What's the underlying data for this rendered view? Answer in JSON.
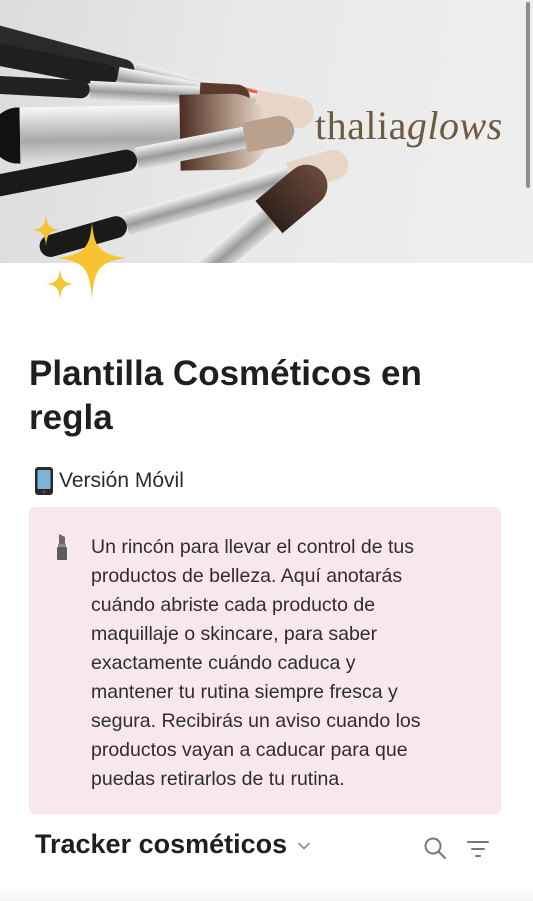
{
  "cover": {
    "brand_prefix": "thalia",
    "brand_suffix": "glows",
    "image_name": "makeup-brushes-cover"
  },
  "page": {
    "icon": "sparkles-icon",
    "title": "Plantilla Cosméticos en regla",
    "version_icon": "mobile-phone-icon",
    "version_label": "Versión Móvil"
  },
  "callout": {
    "icon": "lipstick-icon",
    "background": "#f9e7ef",
    "text": " Un rincón para llevar el control de tus\nproductos de belleza. Aquí anotarás\ncuándo abriste cada producto de\nmaquillaje o skincare, para saber\nexactamente cuándo caduca y\nmantener tu rutina siempre fresca y\nsegura. Recibirás un aviso cuando los\nproductos vayan a caducar para que\npuedas retirarlos de tu rutina."
  },
  "database": {
    "title": "Tracker cosméticos",
    "icons": [
      "chevron-down-icon",
      "search-icon",
      "filter-icon"
    ]
  },
  "colors": {
    "sparkle": "#f6c431",
    "callout_bg": "#f9e7ef",
    "brand": "#6d5a3f"
  }
}
